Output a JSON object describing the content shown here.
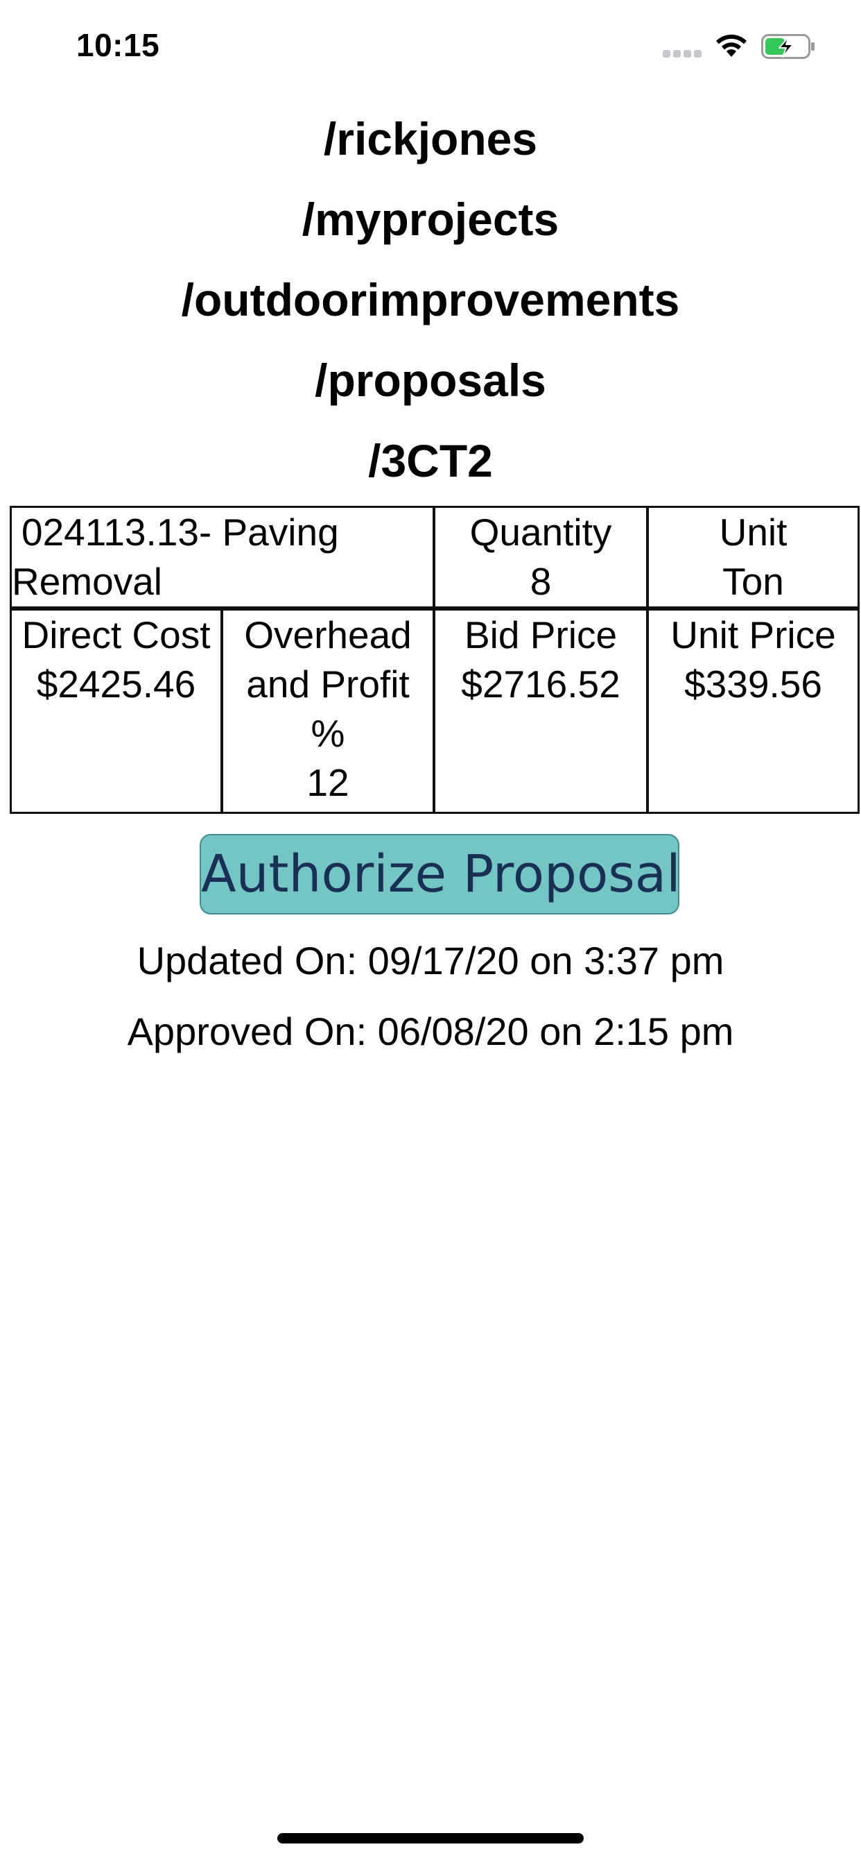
{
  "status_bar": {
    "time": "10:15"
  },
  "breadcrumb": {
    "segments": [
      "/rickjones",
      "/myprojects",
      "/outdoorimprovements",
      "/proposals",
      "/3CT2"
    ]
  },
  "proposal_table": {
    "item_line1": "024113.13- Paving",
    "item_line2": "Removal",
    "quantity": {
      "label": "Quantity",
      "value": "8"
    },
    "unit": {
      "label": "Unit",
      "value": "Ton"
    },
    "direct_cost": {
      "label": "Direct Cost",
      "value": "$2425.46"
    },
    "overhead_profit": {
      "label_line1": "Overhead",
      "label_line2": "and Profit",
      "label_line3": "%",
      "value": "12"
    },
    "bid_price": {
      "label": "Bid Price",
      "value": "$2716.52"
    },
    "unit_price": {
      "label": "Unit Price",
      "value": "$339.56"
    }
  },
  "actions": {
    "authorize_label": "Authorize Proposal"
  },
  "timestamps": {
    "updated": "Updated On: 09/17/20 on 3:37 pm",
    "approved": "Approved On: 06/08/20 on 2:15 pm"
  },
  "colors": {
    "button_background": "#74c6c5",
    "button_text": "#1a2f55",
    "battery_fill": "#34c759"
  },
  "icons": {
    "signal": "cellular-signal-icon",
    "wifi": "wifi-icon",
    "battery": "battery-charging-icon"
  }
}
